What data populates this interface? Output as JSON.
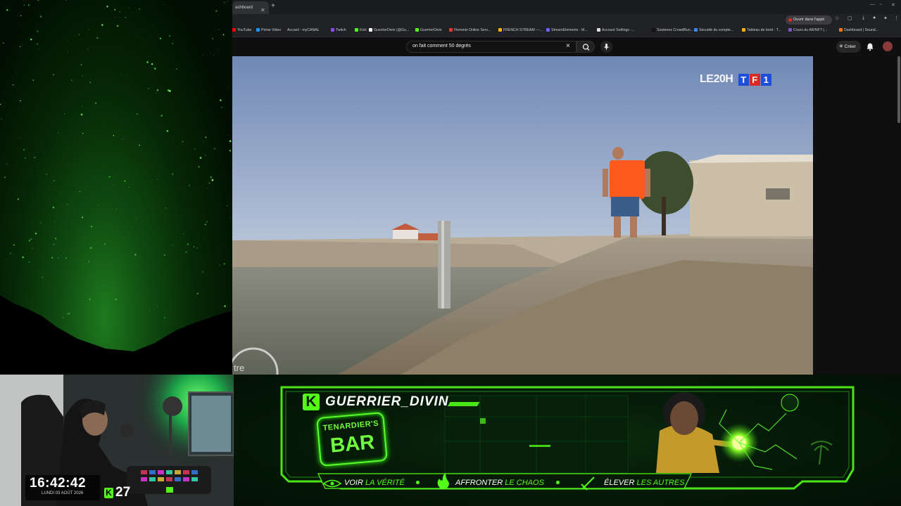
{
  "browser": {
    "active_tab_label": "ashboard",
    "open_app_label": "Ouvrir dans l'appli",
    "bookmarks": [
      {
        "label": "YouTube",
        "color": "#ff0000"
      },
      {
        "label": "Prime Video",
        "color": "#1a98ff"
      },
      {
        "label": "Accueil - myCANAL",
        "color": "#222222"
      },
      {
        "label": "Twitch",
        "color": "#9146ff"
      },
      {
        "label": "Kick",
        "color": "#53fc18"
      },
      {
        "label": "GuerrierDivin (@Gu...",
        "color": "#ffffff"
      },
      {
        "label": "GuerrierDivin",
        "color": "#53fc18"
      },
      {
        "label": "Flemmix Online Serv...",
        "color": "#e53935"
      },
      {
        "label": "FRENCH STREAM —...",
        "color": "#f4b400"
      },
      {
        "label": "StreamElements - M...",
        "color": "#6c63ff"
      },
      {
        "label": "Account Settings -...",
        "color": "#e0e0e0"
      },
      {
        "label": "Soutenez CrowdBun...",
        "color": "#111111"
      },
      {
        "label": "Sécurité du compte...",
        "color": "#4285f4"
      },
      {
        "label": "Tableau de bord - T...",
        "color": "#f4b400"
      },
      {
        "label": "Cours du AR/NFT (...",
        "color": "#7e57c2"
      },
      {
        "label": "Dashboard | Sound...",
        "color": "#ff7700"
      }
    ]
  },
  "youtube": {
    "search_value": "on fait comment 50 degrés",
    "create_label": "Créer"
  },
  "video": {
    "channel_logo_left": "LE20H",
    "channel_logo_letters": [
      "T",
      "F",
      "1"
    ],
    "overlay_text": "tre"
  },
  "webcam": {
    "clock_time": "16:42:42",
    "clock_date": "LUNDI 03 AOÛT 2026",
    "kick_count": "27",
    "kick_letter": "K"
  },
  "overlay": {
    "brand_letter": "K",
    "brand_name": "GUERRIER_DIVIN",
    "sign_top": "TENARDIER'S",
    "sign_main": "BAR",
    "mottos": [
      {
        "verb": "VOIR",
        "highlight": "LA VÉRITÉ",
        "icon": "eye-icon"
      },
      {
        "verb": "AFFRONTER",
        "highlight": "LE CHAOS",
        "icon": "flame-icon"
      },
      {
        "verb": "ÉLEVER",
        "highlight": "LES AUTRES",
        "icon": "sword-icon"
      }
    ],
    "accent_color": "#53fc18"
  }
}
